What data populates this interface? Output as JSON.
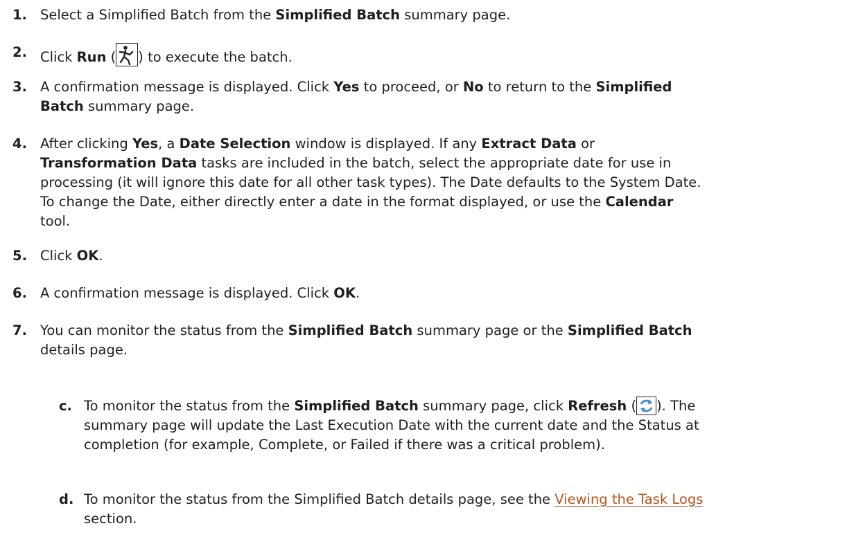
{
  "steps": [
    {
      "num": "1.",
      "parts": [
        {
          "t": "Select a Simplified Batch from the "
        },
        {
          "b": "Simplified Batch"
        },
        {
          "t": " summary page."
        }
      ]
    },
    {
      "num": "2.",
      "parts": [
        {
          "t": "Click "
        },
        {
          "b": "Run"
        },
        {
          "t": " ("
        },
        {
          "icon": "run-icon"
        },
        {
          "t": ") to execute the batch."
        }
      ]
    },
    {
      "num": "3.",
      "parts": [
        {
          "t": "A confirmation message is displayed. Click "
        },
        {
          "b": "Yes"
        },
        {
          "t": " to proceed, or "
        },
        {
          "b": "No"
        },
        {
          "t": " to return to the "
        },
        {
          "b": "Simplified"
        },
        {
          "br": true
        },
        {
          "b": "Batch"
        },
        {
          "t": " summary page."
        }
      ]
    },
    {
      "num": "4.",
      "parts": [
        {
          "t": "After clicking "
        },
        {
          "b": "Yes"
        },
        {
          "t": ", a "
        },
        {
          "b": "Date Selection"
        },
        {
          "t": " window is displayed. If any "
        },
        {
          "b": "Extract Data"
        },
        {
          "t": " or"
        },
        {
          "br": true
        },
        {
          "b": "Transformation Data"
        },
        {
          "t": " tasks are included in the batch, select the appropriate date for use in"
        },
        {
          "br": true
        },
        {
          "t": "processing (it will ignore this date for all other task types). The Date defaults to the System Date."
        },
        {
          "br": true
        },
        {
          "t": "To change the Date, either directly enter a date in the format displayed, or use the "
        },
        {
          "b": "Calendar"
        },
        {
          "br": true
        },
        {
          "t": "tool."
        }
      ]
    },
    {
      "num": "5.",
      "parts": [
        {
          "t": "Click "
        },
        {
          "b": "OK"
        },
        {
          "t": "."
        }
      ]
    },
    {
      "num": "6.",
      "parts": [
        {
          "t": "A confirmation message is displayed. Click "
        },
        {
          "b": "OK"
        },
        {
          "t": "."
        }
      ]
    },
    {
      "num": "7.",
      "parts": [
        {
          "t": "You can monitor the status from the "
        },
        {
          "b": "Simplified Batch"
        },
        {
          "t": " summary page or the "
        },
        {
          "b": "Simplified Batch"
        },
        {
          "br": true
        },
        {
          "t": "details page."
        }
      ]
    },
    {
      "num": "c.",
      "sub": true,
      "parts": [
        {
          "t": "To monitor the status from the "
        },
        {
          "b": "Simplified Batch"
        },
        {
          "t": " summary page, click "
        },
        {
          "b": "Refresh"
        },
        {
          "t": " ("
        },
        {
          "icon": "refresh-icon"
        },
        {
          "t": "). The"
        },
        {
          "br": true
        },
        {
          "t": "summary page will update the Last Execution Date with the current date and the Status at"
        },
        {
          "br": true
        },
        {
          "t": "completion (for example, Complete, or Failed if there was a critical problem)."
        }
      ]
    },
    {
      "num": "d.",
      "sub": true,
      "parts": [
        {
          "t": "To monitor the status from the Simplified Batch details page, see the "
        },
        {
          "link": "Viewing the Task Logs"
        },
        {
          "br": true
        },
        {
          "t": "section."
        }
      ]
    }
  ],
  "colors": {
    "text": "#1f1f1f",
    "link": "#b3541e",
    "refresh_accent": "#4a90c8"
  }
}
